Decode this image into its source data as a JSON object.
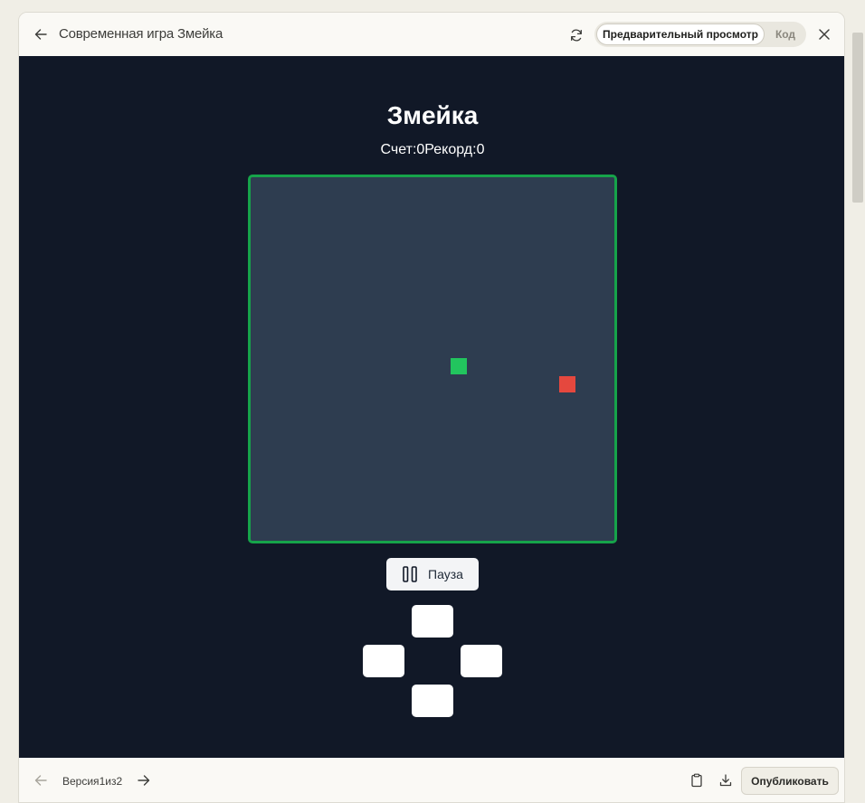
{
  "header": {
    "title": "Современная игра Змейка",
    "toggle": {
      "preview_label": "Предварительный просмотр",
      "code_label": "Код",
      "active": "preview"
    }
  },
  "game": {
    "title": "Змейка",
    "score_label": "Счет: ",
    "score": "0",
    "record_label": "Рекорд: ",
    "record": "0",
    "pause_label": "Пауза"
  },
  "footer": {
    "version_word": "Версия",
    "version_current": "1",
    "version_of": "из",
    "version_total": "2",
    "publish_label": "Опубликовать"
  },
  "icons": {
    "back": "arrow-left-icon",
    "refresh": "refresh-icon",
    "close": "close-icon",
    "pause": "pause-icon",
    "prev": "arrow-left-icon",
    "next": "arrow-right-icon",
    "copy": "clipboard-icon",
    "download": "download-icon"
  },
  "colors": {
    "preview_background": "#111827",
    "board_background": "#2e3d50",
    "board_border": "#16a34a",
    "snake": "#22c55e",
    "food": "#e5483e"
  }
}
